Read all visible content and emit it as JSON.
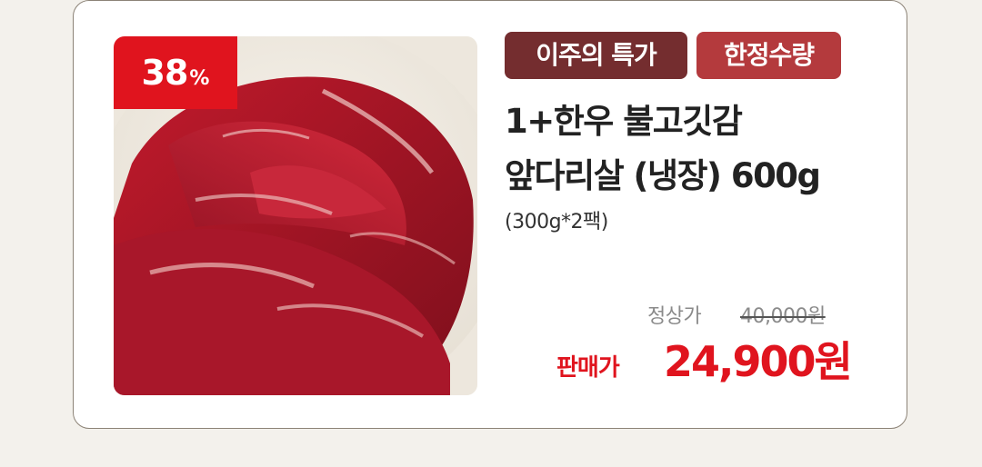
{
  "product": {
    "discount_number": "38",
    "discount_unit": "%",
    "tags": {
      "weekly_special": "이주의 특가",
      "limited_quantity": "한정수량"
    },
    "title_line1": "1+한우 불고깃감",
    "title_line2": "앞다리살 (냉장) 600g",
    "subtitle": "(300g*2팩)",
    "price": {
      "regular_label": "정상가",
      "regular_value": "40,000원",
      "sale_label": "판매가",
      "sale_value": "24,900원"
    }
  },
  "colors": {
    "accent_red": "#e0141e",
    "tag_dark": "#742d2f",
    "tag_light": "#b43a3d",
    "page_bg": "#f3f1ec"
  },
  "icons": {
    "product_image": "sliced-beef-photo"
  }
}
